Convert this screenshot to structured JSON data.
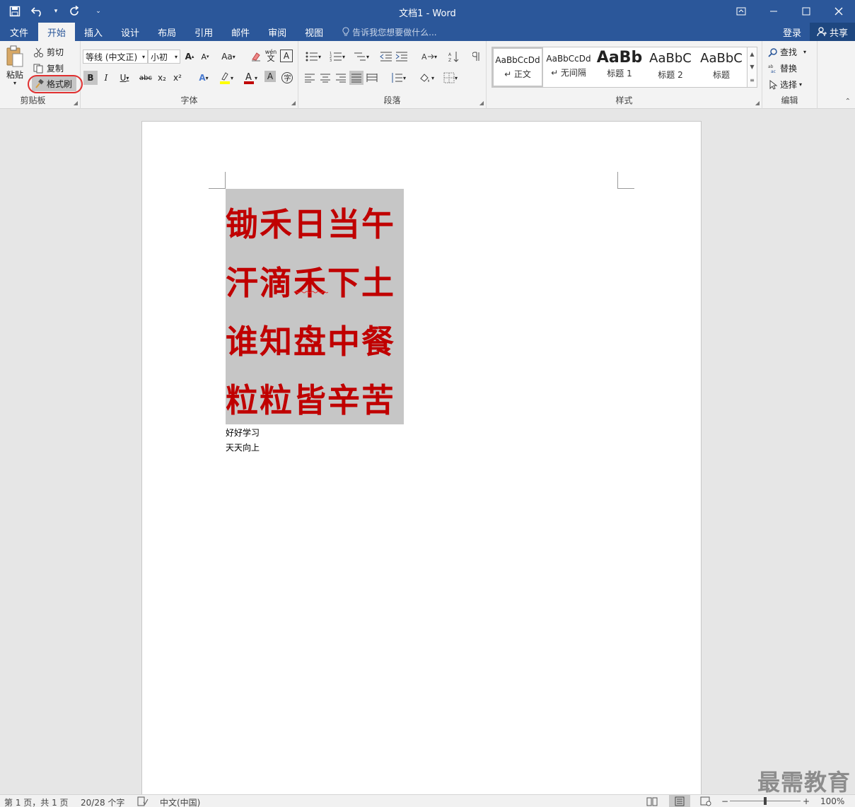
{
  "window": {
    "title": "文档1 - Word"
  },
  "qat": {
    "save": "save-icon",
    "undo": "undo-icon",
    "redo": "redo-icon"
  },
  "tabs": [
    "文件",
    "开始",
    "插入",
    "设计",
    "布局",
    "引用",
    "邮件",
    "审阅",
    "视图"
  ],
  "tell_me": "告诉我您想要做什么...",
  "account": {
    "login": "登录",
    "share": "共享"
  },
  "clipboard": {
    "paste": "粘贴",
    "cut": "剪切",
    "copy": "复制",
    "format_painter": "格式刷",
    "label": "剪贴板"
  },
  "font": {
    "name": "等线 (中文正)",
    "size": "小初",
    "label": "字体",
    "bold": "B",
    "italic": "I",
    "underline": "U",
    "strike": "abc",
    "sub": "x₂",
    "sup": "x²",
    "case": "Aa",
    "phonetic_top": "wén",
    "phonetic_bottom": "文",
    "border_char": "A"
  },
  "paragraph": {
    "label": "段落"
  },
  "styles": {
    "label": "样式",
    "items": [
      {
        "sample": "AaBbCcDd",
        "name": "↵ 正文"
      },
      {
        "sample": "AaBbCcDd",
        "name": "↵ 无间隔"
      },
      {
        "sample": "AaBb",
        "name": "标题 1"
      },
      {
        "sample": "AaBbC",
        "name": "标题 2"
      },
      {
        "sample": "AaBbC",
        "name": "标题"
      }
    ]
  },
  "editing": {
    "find": "查找",
    "replace": "替换",
    "select": "选择",
    "label": "编辑"
  },
  "document": {
    "poem": [
      "锄禾日当午",
      "汗滴禾下土",
      "谁知盘中餐",
      "粒粒皆辛苦"
    ],
    "lines": [
      "好好学习",
      "天天向上"
    ],
    "text_color": "#c00000",
    "highlight": "#c6c6c6"
  },
  "status": {
    "page": "第 1 页，共 1 页",
    "words": "20/28 个字",
    "lang": "中文(中国)",
    "zoom": "100%"
  },
  "watermark": "最需教育"
}
